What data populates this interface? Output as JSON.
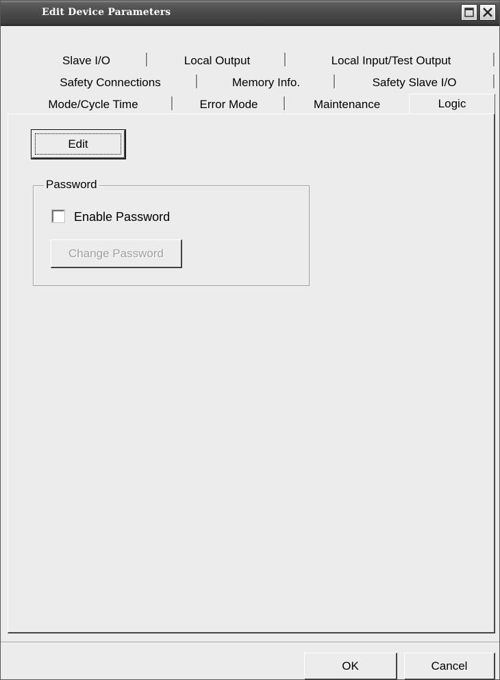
{
  "window": {
    "title": "Edit Device Parameters"
  },
  "titlebar_buttons": [
    {
      "name": "maximize-icon"
    },
    {
      "name": "close-icon"
    }
  ],
  "tabs": {
    "row1": [
      "Slave I/O",
      "Local Output",
      "Local Input/Test Output"
    ],
    "row2": [
      "Safety Connections",
      "Memory Info.",
      "Safety Slave I/O"
    ],
    "row3": [
      "Mode/Cycle Time",
      "Error Mode",
      "Maintenance",
      "Logic"
    ],
    "active": "Logic"
  },
  "logic_panel": {
    "edit_button": "Edit",
    "password_group": {
      "label": "Password",
      "enable_checkbox": {
        "label": "Enable Password",
        "checked": false
      },
      "change_button": {
        "label": "Change Password",
        "disabled": true
      }
    }
  },
  "footer": {
    "ok_label": "OK",
    "cancel_label": "Cancel"
  }
}
